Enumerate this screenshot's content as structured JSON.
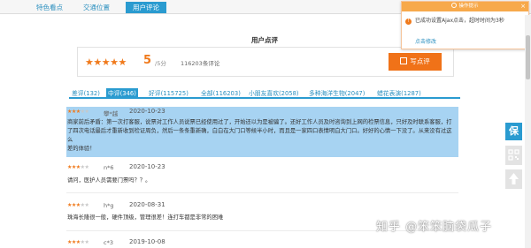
{
  "tabs": [
    {
      "label": "特色看点"
    },
    {
      "label": "交通位置"
    },
    {
      "label": "用户评论",
      "active": true
    }
  ],
  "section_title": "用户点评",
  "summary": {
    "stars": "★★★★★",
    "score": "5",
    "score_unit": "/5分",
    "review_count": "116203条评论",
    "write_label": "写点评"
  },
  "filters": [
    {
      "label": "差评(132)"
    },
    {
      "label": "中评(346)",
      "active": true
    },
    {
      "label": "好评(115725)"
    },
    {
      "label": "全部(116203)"
    },
    {
      "label": "小朋友喜欢(2058)"
    },
    {
      "label": "多种海洋生物(2047)"
    },
    {
      "label": "蜡花表演(1287)"
    }
  ],
  "reviews": [
    {
      "stars_on": "★★★",
      "stars_off": "★★",
      "rating": 3,
      "user": "攀*越",
      "date": "2020-10-23",
      "text": [
        "商家前后矛盾：第一次打客服，说票对工作人员说票已经使用过了，开始还以为是被骗了。还好工作人员及时咨询到上网的检票信息，只好及时联系客服，打",
        "了四次电话最后才重新收到检证周负，然后一条条重新确，白白在大门口等候半小时，而且是一家四口表情明白大门口。好好的心情一下没了。从来没有过这么",
        "差的体验！"
      ]
    },
    {
      "stars_on": "★★★",
      "stars_off": "★★",
      "rating": 3,
      "user": "n*6",
      "date": "2020-10-23",
      "text": [
        "请问，医护人员需要门票吗？？。"
      ]
    },
    {
      "stars_on": "★★★",
      "stars_off": "★★",
      "rating": 3,
      "user": "h*g",
      "date": "2020-08-31",
      "text": [
        "珠海长隆很一般，硬件顶级，管理很差！连打车都是非常的困难"
      ]
    },
    {
      "stars_on": "★★★",
      "stars_off": "★★",
      "rating": 3,
      "user": "c*3",
      "date": "2019-10-08",
      "text": []
    }
  ],
  "notice": {
    "title": "操作提示",
    "close": "×",
    "message": "已成功设置Ajax点击，超时时间为3秒",
    "link": "点击修改"
  },
  "side_buttons": {
    "bao": "保"
  },
  "watermark": "知乎 @笨笨脑袋瓜子",
  "colors": {
    "accent": "#2a9bd0",
    "orange": "#f07218",
    "highlight": "#a7d3f2"
  }
}
